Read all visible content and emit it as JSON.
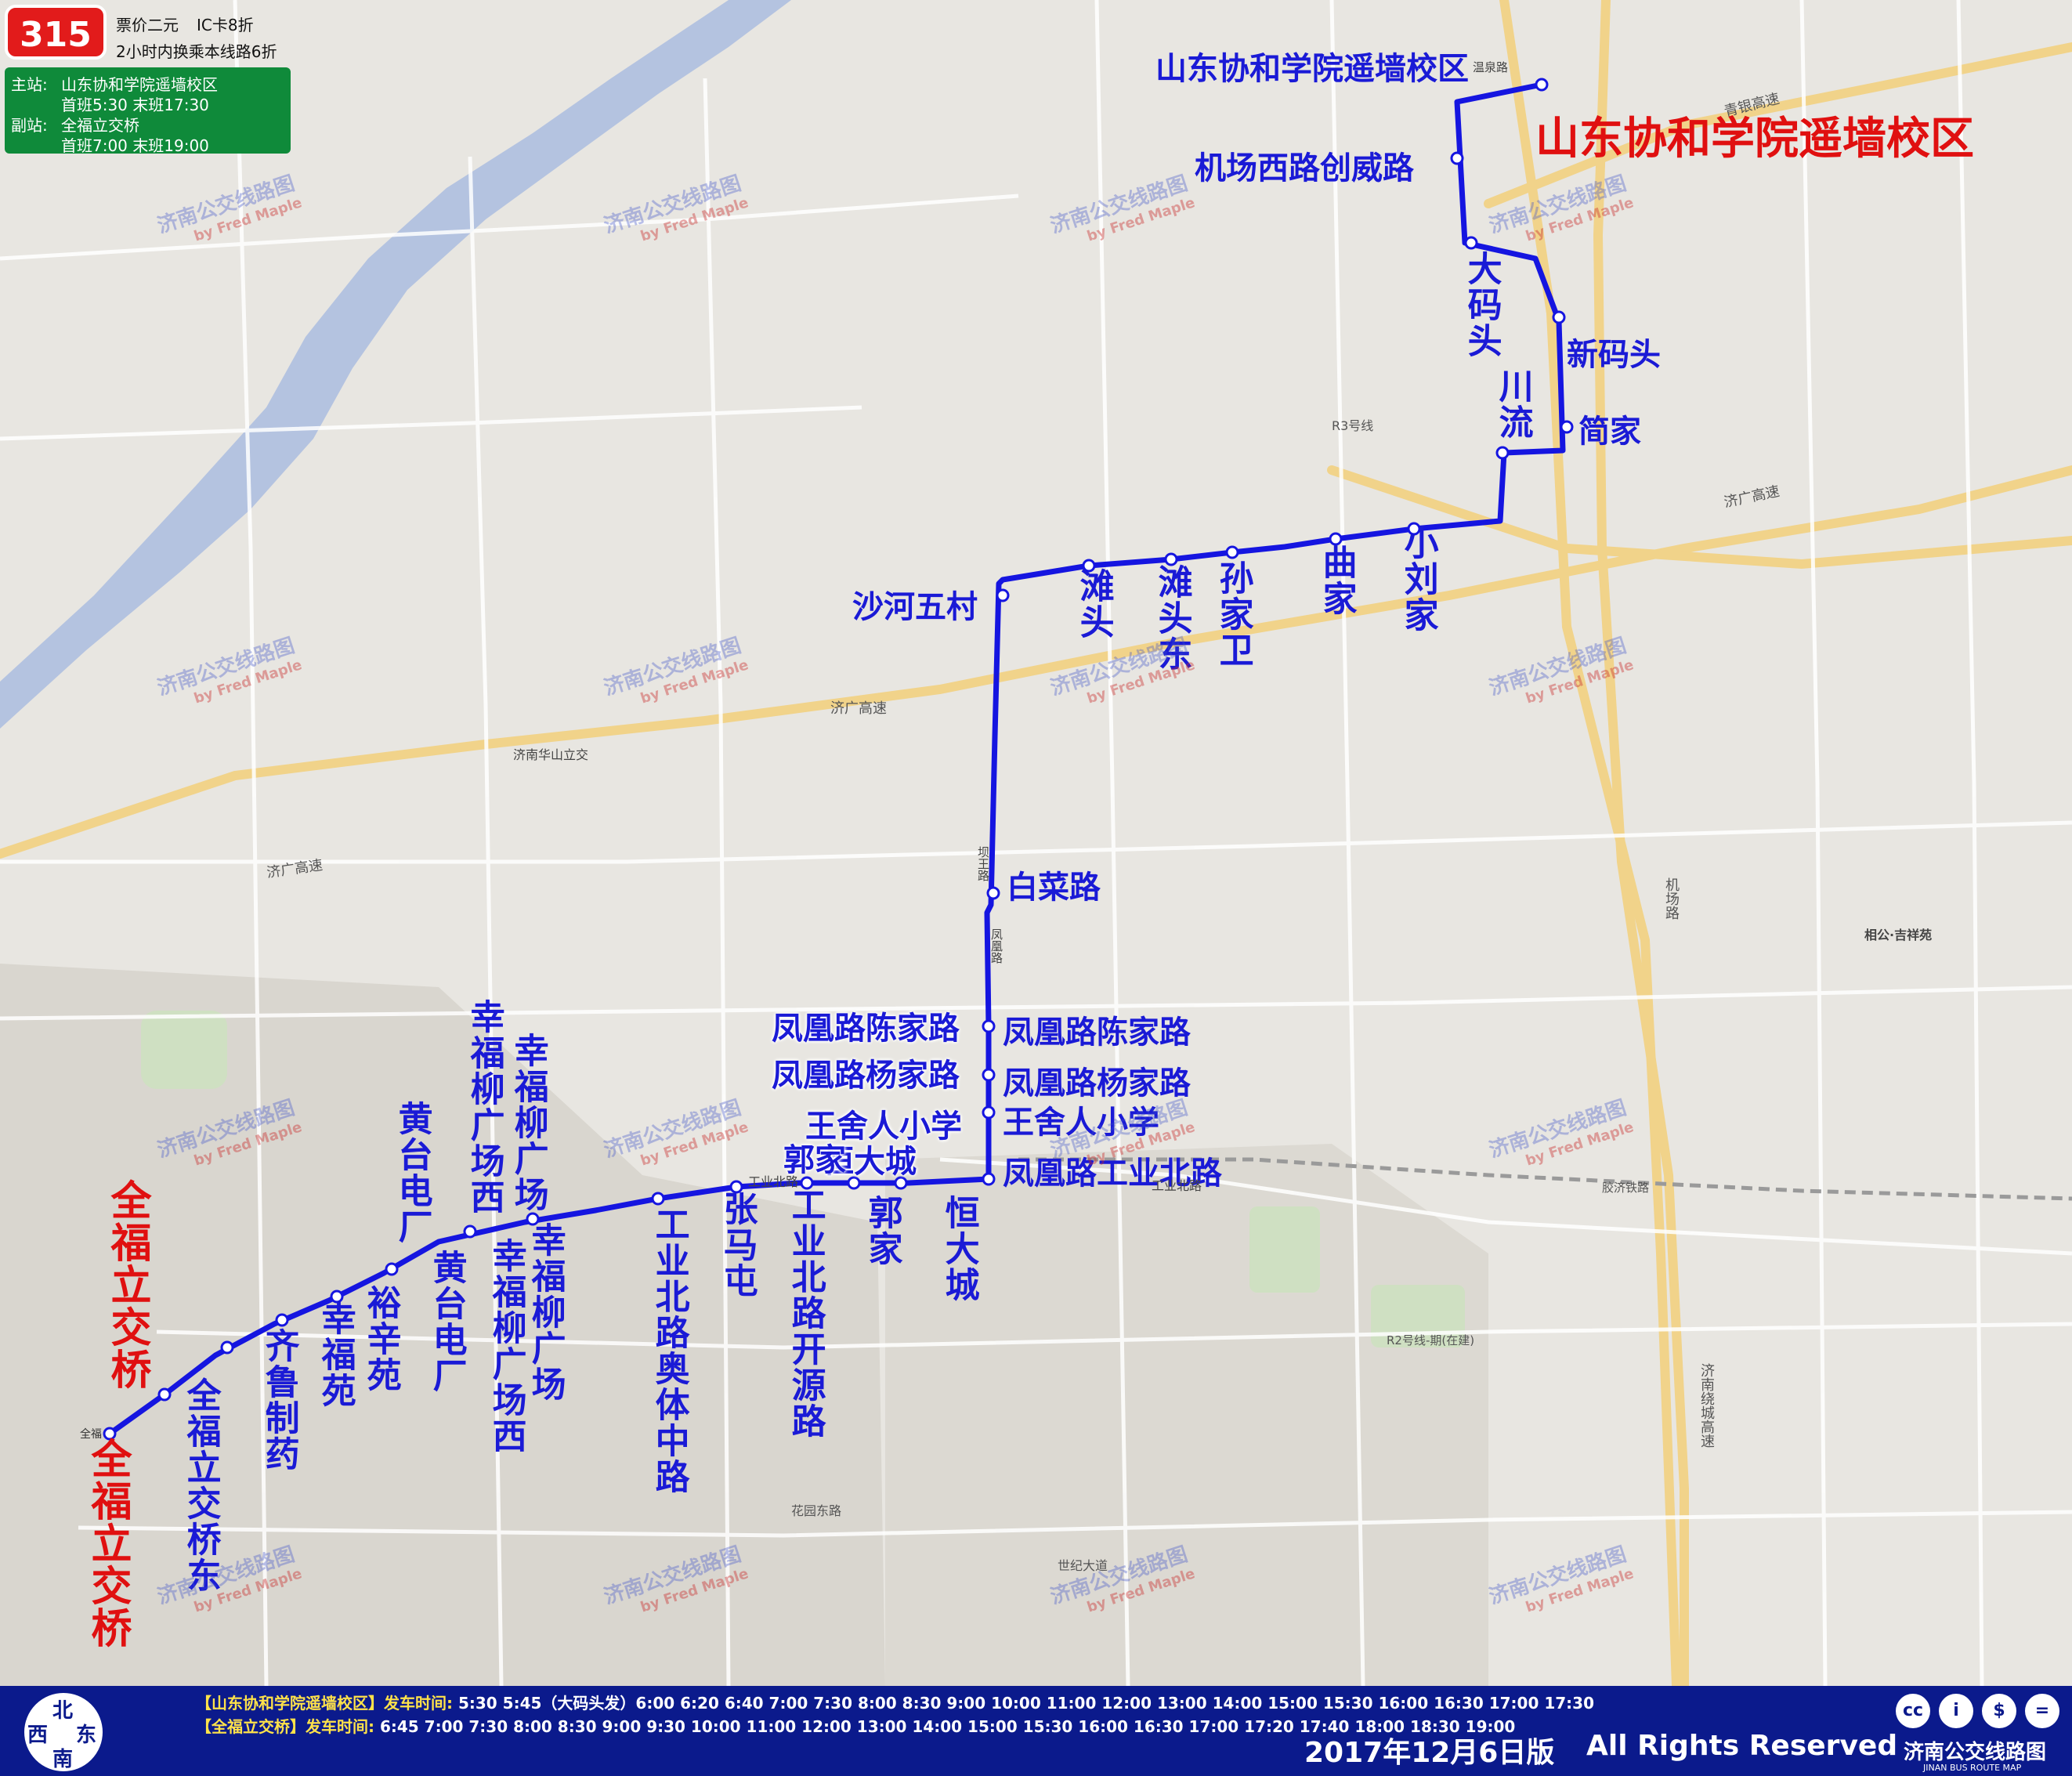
{
  "route": {
    "number": "315",
    "fare": "票价二元",
    "ic_discount": "IC卡8折",
    "transfer": "2小时内换乘本线路6折",
    "main_station_label": "主站:",
    "main_station": "山东协和学院遥墙校区",
    "main_times": "首班5:30  末班17:30",
    "sub_station_label": "副站:",
    "sub_station": "全福立交桥",
    "sub_times": "首班7:00  末班19:00"
  },
  "terminals": {
    "north": "山东协和学院遥墙校区",
    "south": "全福立交桥"
  },
  "stops": {
    "s1": "山东协和学院遥墙校区",
    "s2": "机场西路创威路",
    "s3": "大码头",
    "s4": "新码头",
    "s5": "川流",
    "s6": "简家",
    "s7": "小刘家",
    "s8": "曲家",
    "s9": "孙家卫",
    "s10": "滩头东",
    "s11": "滩头",
    "s12": "沙河五村",
    "s13": "白菜路",
    "s14": "凤凰路陈家路",
    "s15": "凤凰路杨家路",
    "s16": "王舍人小学",
    "s17": "凤凰路工业北路",
    "s18": "恒大城",
    "s19": "郭家",
    "s20": "工业北路开源路",
    "s21": "张马屯",
    "s22": "工业北路奥体中路",
    "s23": "幸福柳广场",
    "s24": "幸福柳广场西",
    "s25": "黄台电厂",
    "s26": "裕辛苑",
    "s27": "幸福苑",
    "s28": "齐鲁制药",
    "s29": "全福立交桥东",
    "s30": "全福立交桥"
  },
  "watermark": {
    "cn": "济南公交线路图",
    "en": "by Fred Maple"
  },
  "map_labels": {
    "expressway_jiguang": "济广高速",
    "qingyin": "青银高速",
    "r3": "R3号线",
    "huashan": "济南华山立交",
    "gongye_bei": "工业北路",
    "jichang_rd": "机场路",
    "fenghuang_rd": "凤凰路",
    "bawang_rd": "坝王路",
    "jinan_rao": "济南绕城高速",
    "wenquan": "温泉路",
    "r2": "R2号线-期(在建)",
    "shiji": "世纪大道",
    "huayuan": "花园东路",
    "quanfu": "全福",
    "gongye_bei2": "工业北路",
    "jiaoji": "胶济铁路",
    "xiangong": "相公·吉祥苑",
    "tieche": "铁车站"
  },
  "footer": {
    "north": "北",
    "south": "南",
    "west": "西",
    "east": "东",
    "sched1_station": "【山东协和学院遥墙校区】",
    "sched1_label": "发车时间: ",
    "sched1_times": "5:30 5:45（大码头发）6:00 6:20 6:40 7:00 7:30 8:00 8:30 9:00 10:00 11:00 12:00 13:00 14:00 15:00 15:30 16:00 16:30 17:00 17:30",
    "sched2_station": "【全福立交桥】",
    "sched2_label": "发车时间: ",
    "sched2_times": "6:45 7:00 7:30 8:00 8:30  9:00 9:30 10:00 11:00 12:00 13:00 14:00 15:00 15:30 16:00 16:30 17:00 17:20 17:40 18:00 18:30 19:00",
    "edition": "2017年12月6日版",
    "rights": "All Rights Reserved",
    "brand": "济南公交线路图",
    "brand_en": "JINAN BUS ROUTE MAP",
    "icon_cc": "cc",
    "icon_person": "i",
    "icon_money": "$",
    "icon_equal": "="
  },
  "colors": {
    "route": "#1515e0",
    "river": "#aebfe0",
    "road_major": "#f4d98c",
    "road_minor": "#ffffff",
    "footer_bg": "#0b1a8c",
    "header_green": "#0f8a3a",
    "route_badge": "#e21b1b"
  }
}
